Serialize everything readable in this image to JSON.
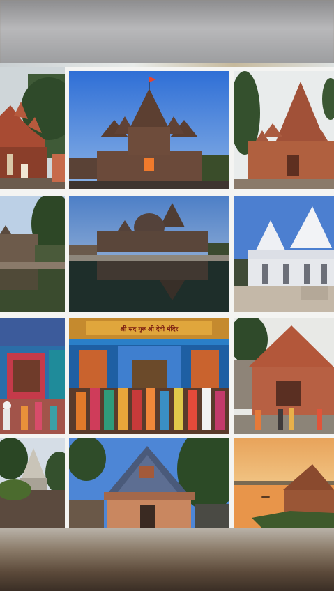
{
  "screen": {
    "content": "temple-photo-collage"
  },
  "tiles": [
    {
      "id": "temple-1",
      "subject": "stone temple with red spires, partial view"
    },
    {
      "id": "temple-2",
      "subject": "stone temple with flag at dusk"
    },
    {
      "id": "temple-3",
      "subject": "red sandstone temple, cloudy sky"
    },
    {
      "id": "temple-4",
      "subject": "temple reflected in pond, partial view"
    },
    {
      "id": "temple-5",
      "subject": "temple complex reflected in tank"
    },
    {
      "id": "temple-6",
      "subject": "white marble temple"
    },
    {
      "id": "temple-7",
      "subject": "colorful temple interior, partial view"
    },
    {
      "id": "temple-8",
      "subject": "temple entrance with crowd of devotees"
    },
    {
      "id": "temple-9",
      "subject": "red temple with pilgrims"
    },
    {
      "id": "temple-10",
      "subject": "small temple on hillside, partial view"
    },
    {
      "id": "temple-11",
      "subject": "temple with carved tiled dome"
    },
    {
      "id": "temple-12",
      "subject": "temple by river at sunset"
    }
  ],
  "signboard": {
    "text": "श्री सद गुरु श्री देवी मंदिर"
  },
  "colors": {
    "separator": "#f4f4f2",
    "sky_blue": "#4c7fd0",
    "sandstone": "#a8563a",
    "sunset": "#e8a35a"
  }
}
